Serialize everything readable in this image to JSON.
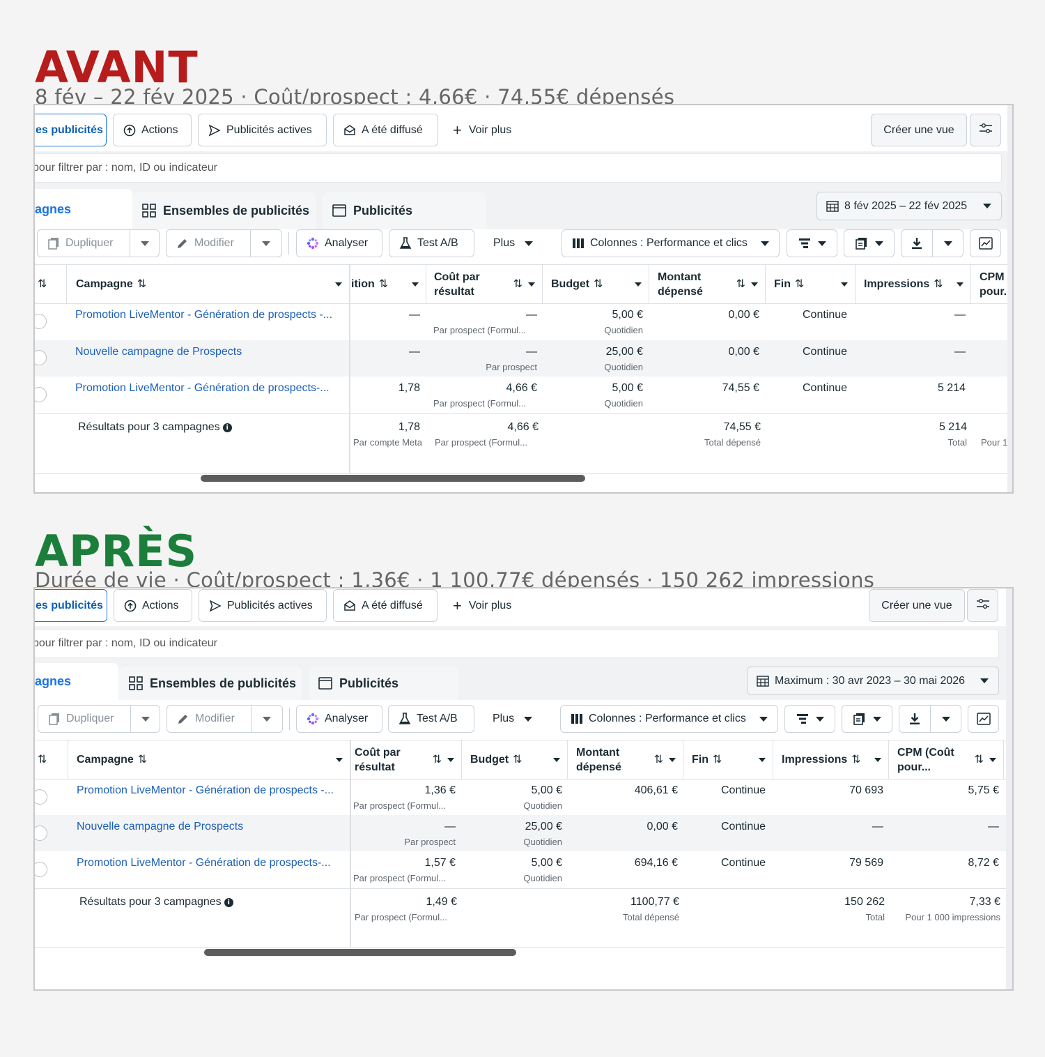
{
  "colors": {
    "before": "#b71c1c",
    "after": "#1b7f3b",
    "link": "#1b5fb8",
    "accent": "#1b74e4"
  },
  "before": {
    "heading": "AVANT",
    "subheading": "8 fév – 22 fév 2025  ·  Coût/prospect : 4,66€  ·  74,55€ dépensés",
    "toolbar": {
      "ads_filter": "es publicités",
      "actions": "Actions",
      "active_ads": "Publicités actives",
      "delivered": "A été diffusé",
      "see_more": "Voir plus",
      "create_view": "Créer une vue"
    },
    "filter_placeholder": "pour filtrer par : nom, ID ou indicateur",
    "tabs": {
      "campaigns": "agnes",
      "adsets": "Ensembles de publicités",
      "ads": "Publicités"
    },
    "date_range": "8 fév 2025 – 22 fév 2025",
    "actions_bar": {
      "duplicate": "Dupliquer",
      "edit": "Modifier",
      "analyze": "Analyser",
      "ab_test": "Test A/B",
      "more": "Plus",
      "columns": "Colonnes : Performance et clics"
    },
    "headers": {
      "campaign": "Campagne",
      "attribution": "ition",
      "cost_per_result": "Coût par résultat",
      "budget": "Budget",
      "amount_spent": "Montant dépensé",
      "end": "Fin",
      "impressions": "Impressions",
      "cpm": "CPM pour."
    },
    "rows": [
      {
        "name": "Promotion LiveMentor - Génération de prospects -...",
        "attribution": "—",
        "cost": "—",
        "cost_sub": "Par prospect (Formul...",
        "budget": "5,00 €",
        "budget_sub": "Quotidien",
        "spent": "0,00 €",
        "end": "Continue",
        "impressions": "—"
      },
      {
        "name": "Nouvelle campagne de Prospects",
        "attribution": "—",
        "cost": "—",
        "cost_sub": "Par prospect",
        "budget": "25,00 €",
        "budget_sub": "Quotidien",
        "spent": "0,00 €",
        "end": "Continue",
        "impressions": "—"
      },
      {
        "name": "Promotion LiveMentor - Génération de prospects-...",
        "attribution": "1,78",
        "cost": "4,66 €",
        "cost_sub": "Par prospect (Formul...",
        "budget": "5,00 €",
        "budget_sub": "Quotidien",
        "spent": "74,55 €",
        "end": "Continue",
        "impressions": "5 214"
      }
    ],
    "totals": {
      "label": "Résultats pour 3 campagnes",
      "attribution": "1,78",
      "attribution_sub": "Par compte Meta",
      "cost": "4,66 €",
      "cost_sub": "Par prospect (Formul...",
      "spent": "74,55 €",
      "spent_sub": "Total dépensé",
      "impressions": "5 214",
      "impressions_sub": "Total",
      "cpm_sub": "Pour 1"
    }
  },
  "after": {
    "heading": "APRÈS",
    "subheading": "Durée de vie  ·  Coût/prospect : 1,36€  ·  1 100,77€ dépensés  ·  150 262 impressions",
    "toolbar": {
      "ads_filter": "es publicités",
      "actions": "Actions",
      "active_ads": "Publicités actives",
      "delivered": "A été diffusé",
      "see_more": "Voir plus",
      "create_view": "Créer une vue"
    },
    "filter_placeholder": "pour filtrer par : nom, ID ou indicateur",
    "tabs": {
      "campaigns": "agnes",
      "adsets": "Ensembles de publicités",
      "ads": "Publicités"
    },
    "date_range": "Maximum : 30 avr 2023 – 30 mai 2026",
    "actions_bar": {
      "duplicate": "Dupliquer",
      "edit": "Modifier",
      "analyze": "Analyser",
      "ab_test": "Test A/B",
      "more": "Plus",
      "columns": "Colonnes : Performance et clics"
    },
    "headers": {
      "campaign": "Campagne",
      "cost_per_result": "Coût par résultat",
      "budget": "Budget",
      "amount_spent": "Montant dépensé",
      "end": "Fin",
      "impressions": "Impressions",
      "cpm": "CPM (Coût pour..."
    },
    "rows": [
      {
        "name": "Promotion LiveMentor - Génération de prospects -...",
        "cost": "1,36 €",
        "cost_sub": "Par prospect (Formul...",
        "budget": "5,00 €",
        "budget_sub": "Quotidien",
        "spent": "406,61 €",
        "end": "Continue",
        "impressions": "70 693",
        "cpm": "5,75 €"
      },
      {
        "name": "Nouvelle campagne de Prospects",
        "cost": "—",
        "cost_sub": "Par prospect",
        "budget": "25,00 €",
        "budget_sub": "Quotidien",
        "spent": "0,00 €",
        "end": "Continue",
        "impressions": "—",
        "cpm": "—"
      },
      {
        "name": "Promotion LiveMentor - Génération de prospects-...",
        "cost": "1,57 €",
        "cost_sub": "Par prospect (Formul...",
        "budget": "5,00 €",
        "budget_sub": "Quotidien",
        "spent": "694,16 €",
        "end": "Continue",
        "impressions": "79 569",
        "cpm": "8,72 €"
      }
    ],
    "totals": {
      "label": "Résultats pour 3 campagnes",
      "cost": "1,49 €",
      "cost_sub": "Par prospect (Formul...",
      "spent": "1100,77 €",
      "spent_sub": "Total dépensé",
      "impressions": "150 262",
      "impressions_sub": "Total",
      "cpm": "7,33 €",
      "cpm_sub": "Pour 1 000 impressions"
    }
  }
}
